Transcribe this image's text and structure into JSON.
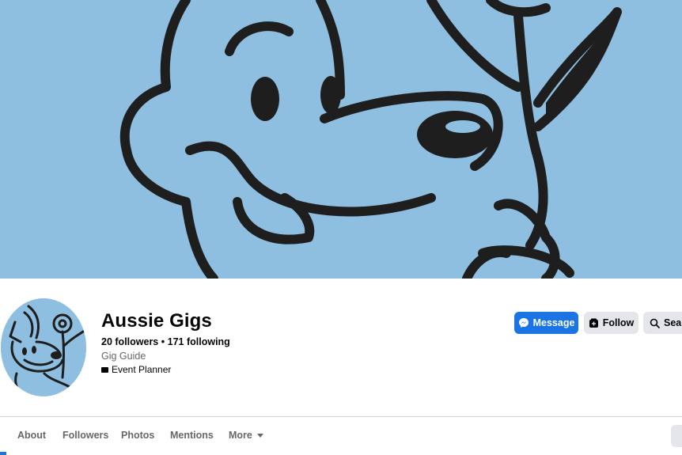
{
  "page": {
    "name": "Aussie Gigs",
    "followers_count": "20",
    "followers_label": "followers",
    "separator": "•",
    "following_count": "171",
    "following_label": "following",
    "category": "Gig Guide",
    "role": "Event Planner"
  },
  "actions": {
    "message_label": "Message",
    "follow_label": "Follow",
    "search_label": "Sear"
  },
  "tabs": [
    {
      "label": "About"
    },
    {
      "label": "Followers"
    },
    {
      "label": "Photos"
    },
    {
      "label": "Mentions"
    },
    {
      "label": "More"
    }
  ],
  "colors": {
    "cover_background": "#8fbfe0",
    "primary_button": "#1b74e4",
    "secondary_button": "#e4e6eb",
    "muted_text": "#65676b"
  },
  "icons": {
    "message_button": "messenger-icon",
    "follow_button": "follow-icon",
    "search_button": "search-icon",
    "role": "briefcase-icon",
    "more_tab": "caret-down-icon"
  }
}
